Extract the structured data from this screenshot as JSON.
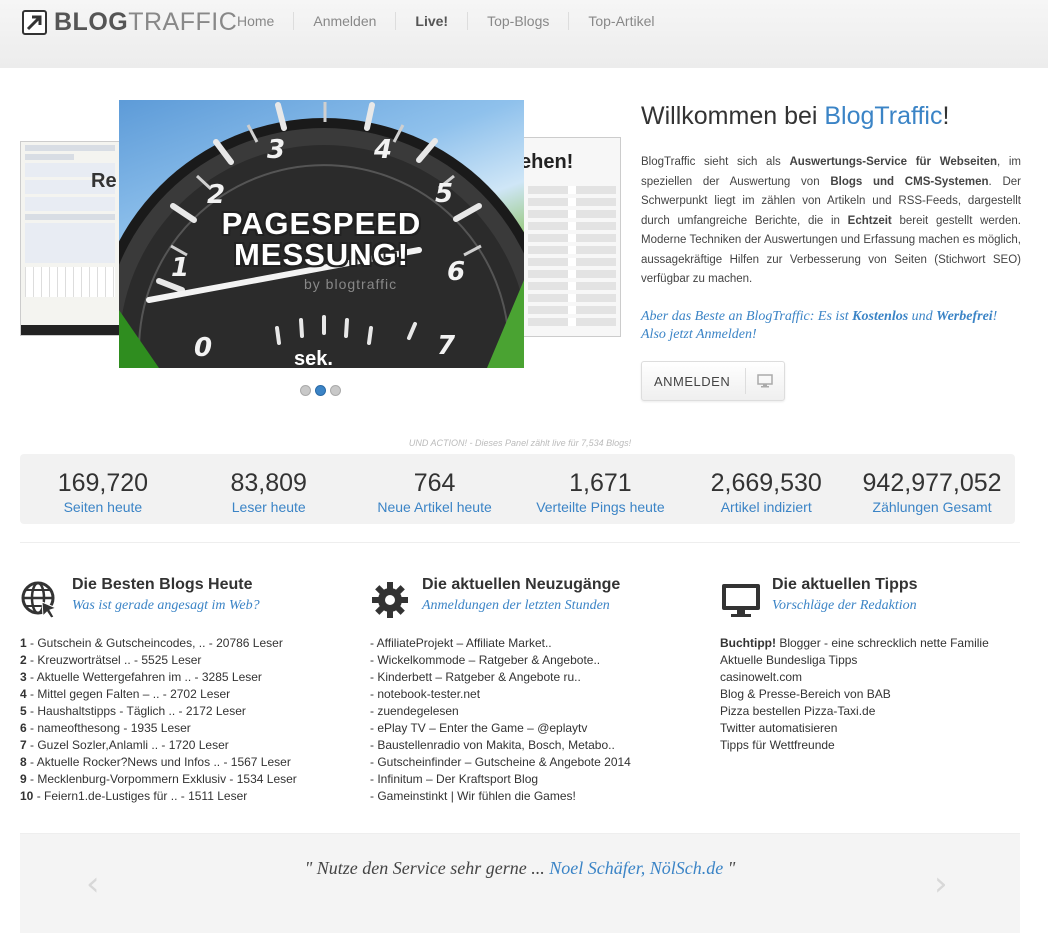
{
  "brand": {
    "part1": "BLOG",
    "part2": "TRAFFIC"
  },
  "nav": [
    "Home",
    "Anmelden",
    "Live!",
    "Top-Blogs",
    "Top-Artikel"
  ],
  "slider": {
    "left_label": "Re",
    "right_label": "ehen!",
    "title_line1": "PAGESPEED",
    "title_line2": "MESSUNG!",
    "by": "by blogtraffic",
    "unit": "sek.",
    "gauge_numbers": [
      "0",
      "1",
      "2",
      "3",
      "4",
      "5",
      "6",
      "7"
    ],
    "active_slide": 2,
    "slide_count": 3
  },
  "welcome": {
    "title_prefix": "Willkommen bei ",
    "title_brand": "BlogTraffic",
    "title_suffix": "!",
    "p1": "BlogTraffic sieht sich als ",
    "p1_b": "Auswertungs-Service für Webseiten",
    "p2": ", im speziellen der Auswertung von ",
    "p2_b": "Blogs und CMS-Systemen",
    "p3": ". Der Schwerpunkt liegt im zählen von Artikeln und RSS-Feeds, dargestellt durch umfangreiche Berichte, die in ",
    "p3_b": "Echtzeit",
    "p4": " bereit gestellt werden. Moderne Techniken der Auswertungen und Erfassung machen es möglich, aussagekräftige Hilfen zur Verbesserung von Seiten (Stichwort SEO) verfügbar zu machen.",
    "cta1": "Aber das Beste an BlogTraffic: Es ist ",
    "cta_b1": "Kostenlos",
    "cta2": " und ",
    "cta_b2": "Werbefrei",
    "cta3": "! Also jetzt Anmelden!",
    "button": "ANMELDEN"
  },
  "action_text": "UND ACTION! - Dieses Panel zählt live für 7,534 Blogs!",
  "stats": [
    {
      "num": "169,720",
      "label": "Seiten heute"
    },
    {
      "num": "83,809",
      "label": "Leser heute"
    },
    {
      "num": "764",
      "label": "Neue Artikel heute"
    },
    {
      "num": "1,671",
      "label": "Verteilte Pings heute"
    },
    {
      "num": "2,669,530",
      "label": "Artikel indiziert"
    },
    {
      "num": "942,977,052",
      "label": "Zählungen Gesamt"
    }
  ],
  "best": {
    "title": "Die Besten Blogs Heute",
    "subtitle": "Was ist gerade angesagt im Web?",
    "items": [
      {
        "rank": "1",
        "text": " - Gutschein & Gutscheincodes, .. - 20786 Leser"
      },
      {
        "rank": "2",
        "text": " - Kreuzworträtsel .. - 5525 Leser"
      },
      {
        "rank": "3",
        "text": " - Aktuelle Wettergefahren im .. - 3285 Leser"
      },
      {
        "rank": "4",
        "text": " - Mittel gegen Falten – .. - 2702 Leser"
      },
      {
        "rank": "5",
        "text": " - Haushaltstipps - Täglich .. - 2172 Leser"
      },
      {
        "rank": "6",
        "text": " - nameofthesong - 1935 Leser"
      },
      {
        "rank": "7",
        "text": " - Guzel Sozler,Anlamli .. - 1720 Leser"
      },
      {
        "rank": "8",
        "text": " - Aktuelle Rocker?News und Infos .. - 1567 Leser"
      },
      {
        "rank": "9",
        "text": " - Mecklenburg-Vorpommern Exklusiv - 1534 Leser"
      },
      {
        "rank": "10",
        "text": " - Feiern1.de-Lustiges für .. - 1511 Leser"
      }
    ]
  },
  "new": {
    "title": "Die aktuellen Neuzugänge",
    "subtitle": "Anmeldungen der letzten Stunden",
    "items": [
      "- AffiliateProjekt – Affiliate Market..",
      "- Wickelkommode – Ratgeber & Angebote..",
      "- Kinderbett – Ratgeber & Angebote ru..",
      "- notebook-tester.net",
      "- zuendegelesen",
      "- ePlay TV – Enter the Game – @eplaytv",
      "- Baustellenradio von Makita, Bosch, Metabo..",
      "- Gutscheinfinder – Gutscheine & Angebote 2014",
      "- Infinitum – Der Kraftsport Blog",
      "- Gameinstinkt | Wir fühlen die Games!"
    ]
  },
  "tips": {
    "title": "Die aktuellen Tipps",
    "subtitle": "Vorschläge der Redaktion",
    "first_bold": "Buchtipp!",
    "first_rest": " Blogger - eine schrecklich nette Familie",
    "items": [
      "Aktuelle Bundesliga Tipps",
      "casinowelt.com",
      "Blog & Presse-Bereich von BAB",
      "Pizza bestellen Pizza-Taxi.de",
      "Twitter automatisieren",
      "Tipps für Wettfreunde"
    ]
  },
  "testimonial": {
    "open": "\" Nutze den Service sehr gerne ... ",
    "who": "Noel Schäfer, NölSch.de",
    "close": " \""
  },
  "colors": {
    "accent": "#3b84c6",
    "text": "#333333",
    "panel": "#f2f2f2"
  }
}
